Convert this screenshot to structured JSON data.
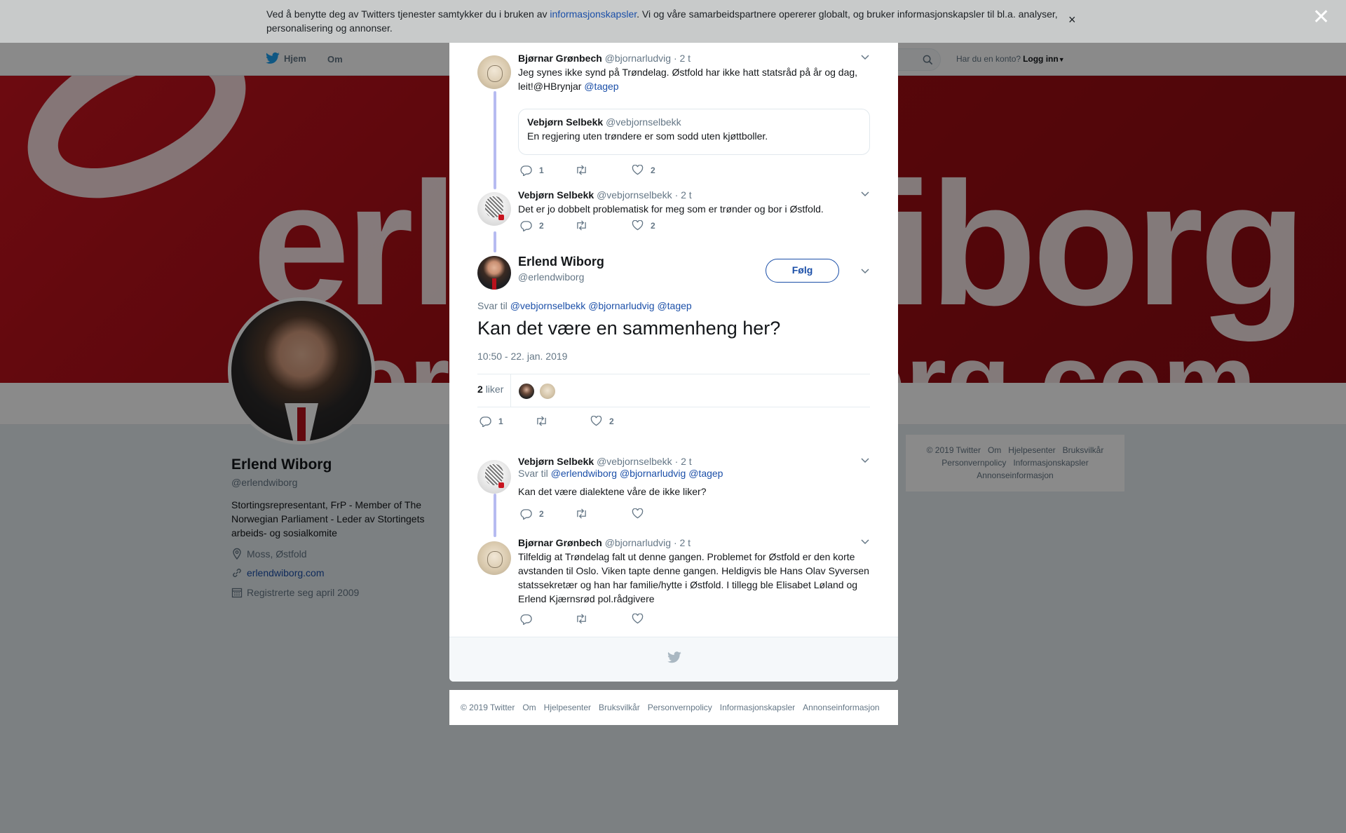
{
  "cookie": {
    "text_before": "Ved å benytte deg av Twitters tjenester samtykker du i bruken av ",
    "link": "informasjonskapsler",
    "text_after": ". Vi og våre samarbeidspartnere opererer globalt, og bruker informasjonskapsler til bl.a. analyser, personalisering og annonser.",
    "close": "×"
  },
  "modal_close": "✕",
  "nav": {
    "home": "Hjem",
    "about": "Om",
    "login_prompt": "Har du en konto?",
    "login": "Logg inn"
  },
  "banner": {
    "line1": "erlendwiborg",
    "line2": "erlendwiborg.com"
  },
  "profile": {
    "name": "Erlend Wiborg",
    "handle": "@erlendwiborg",
    "bio": "Stortingsrepresentant, FrP - Member of The Norwegian Parliament - Leder av Stortingets arbeids- og sosialkomite",
    "location": "Moss, Østfold",
    "website": "erlendwiborg.com",
    "joined": "Registrerte seg april 2009"
  },
  "side_footer": [
    "© 2019 Twitter",
    "Om",
    "Hjelpesenter",
    "Bruksvilkår",
    "Personvernpolicy",
    "Informasjonskapsler",
    "Annonseinformasjon"
  ],
  "thread": {
    "t1": {
      "name": "Bjørnar Grønbech",
      "handle": "@bjornarludvig",
      "time": "· 2 t",
      "text": "Jeg synes ikke synd på Trøndelag. Østfold har ikke hatt statsråd på år og dag, leit!@HBrynjar ",
      "mention": "@tagep",
      "quote": {
        "name": "Vebjørn Selbekk",
        "handle": "@vebjornselbekk",
        "text": "En regjering uten trøndere er som sodd uten kjøttboller."
      },
      "replies": "1",
      "likes": "2"
    },
    "t2": {
      "name": "Vebjørn Selbekk",
      "handle": "@vebjornselbekk",
      "time": "· 2 t",
      "text": "Det er jo dobbelt problematisk for meg som er trønder og bor i Østfold.",
      "replies": "2",
      "likes": "2"
    },
    "main": {
      "name": "Erlend Wiborg",
      "handle": "@erlendwiborg",
      "follow": "Følg",
      "reply_prefix": "Svar til",
      "mentions": [
        "@vebjornselbekk",
        "@bjornarludvig",
        "@tagep"
      ],
      "text": "Kan det være en sammenheng her?",
      "date": "10:50 - 22. jan. 2019",
      "likes_count": "2",
      "likes_label": "liker",
      "replies": "1",
      "likes": "2"
    },
    "t3": {
      "name": "Vebjørn Selbekk",
      "handle": "@vebjornselbekk",
      "time": "· 2 t",
      "reply_prefix": "Svar til",
      "mentions": [
        "@erlendwiborg",
        "@bjornarludvig",
        "@tagep"
      ],
      "text": "Kan det være dialektene våre de ikke liker?",
      "replies": "2"
    },
    "t4": {
      "name": "Bjørnar Grønbech",
      "handle": "@bjornarludvig",
      "time": "· 2 t",
      "text": "Tilfeldig at Trøndelag falt ut denne gangen. Problemet for Østfold er den korte avstanden til Oslo. Viken tapte denne gangen. Heldigvis ble Hans Olav Syversen statssekretær og han har familie/hytte i Østfold. I tillegg ble Elisabet Løland og Erlend Kjærnsrød pol.rådgivere"
    }
  },
  "footer": [
    "© 2019 Twitter",
    "Om",
    "Hjelpesenter",
    "Bruksvilkår",
    "Personvernpolicy",
    "Informasjonskapsler",
    "Annonseinformasjon"
  ],
  "colors": {
    "link": "#1b4fa8",
    "banner_red": "#c8141f",
    "thread_line": "#b6bbf1"
  }
}
